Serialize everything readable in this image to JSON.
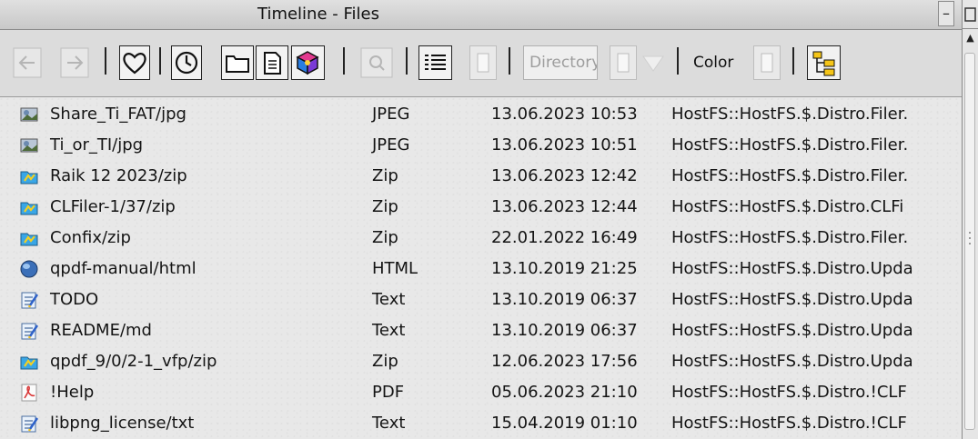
{
  "window": {
    "title": "Timeline - Files"
  },
  "toolbar": {
    "directory_field": "Directory",
    "color_label": "Color"
  },
  "files": [
    {
      "name": "Share_Ti_FAT/jpg",
      "type": "JPEG",
      "date": "13.06.2023 10:53",
      "path": "HostFS::HostFS.$.Distro.Filer.",
      "icon": "jpeg-file-icon"
    },
    {
      "name": "Ti_or_TI/jpg",
      "type": "JPEG",
      "date": "13.06.2023 10:51",
      "path": "HostFS::HostFS.$.Distro.Filer.",
      "icon": "jpeg-file-icon"
    },
    {
      "name": "Raik 12 2023/zip",
      "type": "Zip",
      "date": "13.06.2023 12:42",
      "path": "HostFS::HostFS.$.Distro.Filer.",
      "icon": "zip-file-icon"
    },
    {
      "name": "CLFiler-1/37/zip",
      "type": "Zip",
      "date": "13.06.2023 12:44",
      "path": "HostFS::HostFS.$.Distro.CLFi",
      "icon": "zip-file-icon"
    },
    {
      "name": "Confix/zip",
      "type": "Zip",
      "date": "22.01.2022 16:49",
      "path": "HostFS::HostFS.$.Distro.Filer.",
      "icon": "zip-file-icon"
    },
    {
      "name": "qpdf-manual/html",
      "type": "HTML",
      "date": "13.10.2019 21:25",
      "path": "HostFS::HostFS.$.Distro.Upda",
      "icon": "html-file-icon"
    },
    {
      "name": "TODO",
      "type": "Text",
      "date": "13.10.2019 06:37",
      "path": "HostFS::HostFS.$.Distro.Upda",
      "icon": "text-file-icon"
    },
    {
      "name": "README/md",
      "type": "Text",
      "date": "13.10.2019 06:37",
      "path": "HostFS::HostFS.$.Distro.Upda",
      "icon": "text-file-icon"
    },
    {
      "name": "qpdf_9/0/2-1_vfp/zip",
      "type": "Zip",
      "date": "12.06.2023 17:56",
      "path": "HostFS::HostFS.$.Distro.Upda",
      "icon": "zip-file-icon"
    },
    {
      "name": "!Help",
      "type": "PDF",
      "date": "05.06.2023 21:10",
      "path": "HostFS::HostFS.$.Distro.!CLF",
      "icon": "pdf-file-icon"
    },
    {
      "name": "libpng_license/txt",
      "type": "Text",
      "date": "15.04.2019 01:10",
      "path": "HostFS::HostFS.$.Distro.!CLF",
      "icon": "text-file-icon"
    }
  ]
}
